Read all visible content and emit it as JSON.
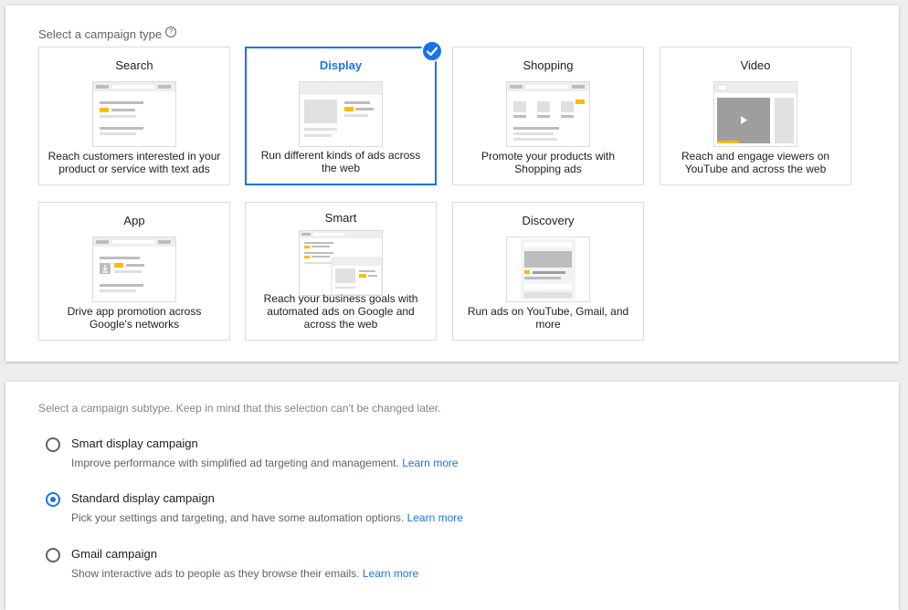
{
  "campaign_type": {
    "label": "Select a campaign type",
    "help_icon": "help-circle-icon",
    "selected_indicator_icon": "check-circle-icon",
    "accent_color": "#1a73e8",
    "cards": [
      {
        "id": "search",
        "title": "Search",
        "description": "Reach customers interested in your product or service with text ads",
        "selected": false
      },
      {
        "id": "display",
        "title": "Display",
        "description": "Run different kinds of ads across the web",
        "selected": true
      },
      {
        "id": "shopping",
        "title": "Shopping",
        "description": "Promote your products with Shopping ads",
        "selected": false
      },
      {
        "id": "video",
        "title": "Video",
        "description": "Reach and engage viewers on YouTube and across the web",
        "selected": false
      },
      {
        "id": "app",
        "title": "App",
        "description": "Drive app promotion across Google's networks",
        "selected": false
      },
      {
        "id": "smart",
        "title": "Smart",
        "description": "Reach your business goals with automated ads on Google and across the web",
        "selected": false
      },
      {
        "id": "discovery",
        "title": "Discovery",
        "description": "Run ads on YouTube, Gmail, and more",
        "selected": false
      }
    ]
  },
  "campaign_subtype": {
    "label": "Select a campaign subtype. Keep in mind that this selection can't be changed later.",
    "learn_more": "Learn more",
    "options": [
      {
        "title": "Smart display campaign",
        "description": "Improve performance with simplified ad targeting and management.",
        "checked": false
      },
      {
        "title": "Standard display campaign",
        "description": "Pick your settings and targeting, and have some automation options.",
        "checked": true
      },
      {
        "title": "Gmail campaign",
        "description": "Show interactive ads to people as they browse their emails.",
        "checked": false
      }
    ]
  }
}
